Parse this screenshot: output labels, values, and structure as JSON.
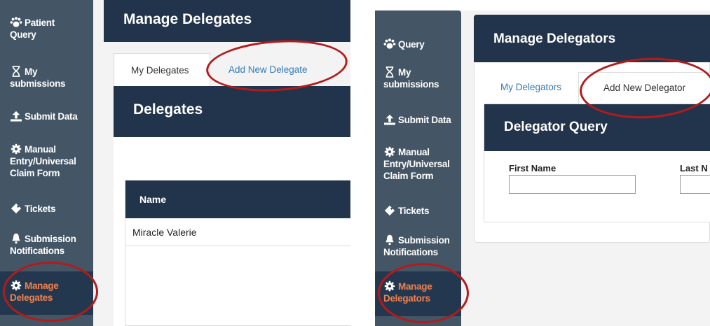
{
  "left": {
    "sidebar": [
      {
        "label": "Patient\nQuery",
        "icon": "paw-icon"
      },
      {
        "label": "My\nsubmissions",
        "icon": "hourglass-icon"
      },
      {
        "label": "Submit Data",
        "icon": "upload-icon"
      },
      {
        "label": "Manual\nEntry/Universal\nClaim Form",
        "icon": "gear-icon"
      },
      {
        "label": "Tickets",
        "icon": "ticket-icon"
      },
      {
        "label": "Submission\nNotifications",
        "icon": "bell-icon"
      },
      {
        "label": "Manage\nDelegates",
        "icon": "gear-icon",
        "active": true
      }
    ],
    "page_title": "Manage Delegates",
    "tabs": [
      {
        "label": "My Delegates",
        "active": true
      },
      {
        "label": "Add New Delegate",
        "active": false
      }
    ],
    "card_title": "Delegates",
    "table": {
      "column_header": "Name",
      "rows": [
        "Miracle Valerie"
      ]
    }
  },
  "right": {
    "sidebar": [
      {
        "label": "Query",
        "icon": "paw-icon"
      },
      {
        "label": "My\nsubmissions",
        "icon": "hourglass-icon"
      },
      {
        "label": "Submit Data",
        "icon": "upload-icon"
      },
      {
        "label": "Manual\nEntry/Universal\nClaim Form",
        "icon": "gear-icon"
      },
      {
        "label": "Tickets",
        "icon": "ticket-icon"
      },
      {
        "label": "Submission\nNotifications",
        "icon": "bell-icon"
      },
      {
        "label": "Manage\nDelegators",
        "icon": "gear-icon",
        "active": true
      }
    ],
    "page_title": "Manage Delegators",
    "tabs": [
      {
        "label": "My Delegators",
        "active": false
      },
      {
        "label": "Add New Delegator",
        "active": true
      }
    ],
    "card_title": "Delegator Query",
    "fields": [
      {
        "label": "First Name",
        "value": ""
      },
      {
        "label": "Last N",
        "value": ""
      }
    ]
  },
  "colors": {
    "sidebar": "#445566",
    "header": "#22344c",
    "active_nav_text": "#f08050",
    "link": "#337ab7",
    "highlight_circle": "#b31b1b"
  }
}
